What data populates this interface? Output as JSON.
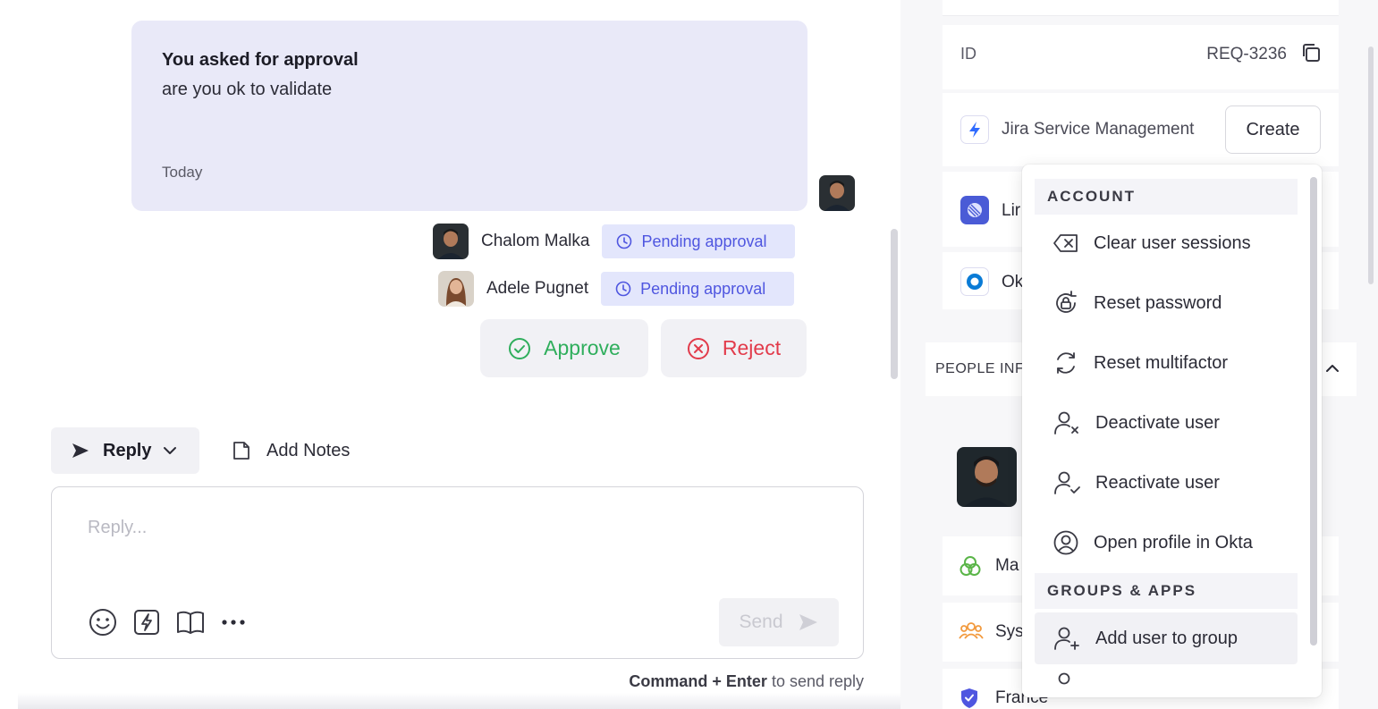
{
  "conversation": {
    "approval_message": {
      "title": "You asked for approval",
      "body": "are you ok to validate",
      "timestamp": "Today"
    },
    "approvers": [
      {
        "name": "Chalom Malka",
        "status": "Pending approval"
      },
      {
        "name": "Adele Pugnet",
        "status": "Pending approval"
      }
    ],
    "actions": {
      "approve_label": "Approve",
      "reject_label": "Reject"
    }
  },
  "composer": {
    "reply_tab_label": "Reply",
    "notes_tab_label": "Add Notes",
    "placeholder": "Reply...",
    "send_label": "Send",
    "hint_keys": "Command + Enter",
    "hint_text": " to send reply"
  },
  "sidebar": {
    "id_label": "ID",
    "id_value": "REQ-3236",
    "jira_name": "Jira Service Management",
    "create_label": "Create",
    "lin_name": "Lir",
    "okta_name": "Ok",
    "people_title": "PEOPLE INF",
    "info_rows": [
      "Ma",
      "Sys",
      "France"
    ]
  },
  "menu": {
    "section_account": "ACCOUNT",
    "items_account": [
      "Clear user sessions",
      "Reset password",
      "Reset multifactor",
      "Deactivate user",
      "Reactivate user",
      "Open profile in Okta"
    ],
    "section_groups": "GROUPS & APPS",
    "items_groups": [
      "Add user to group"
    ]
  },
  "colors": {
    "bubble_bg": "#e9e9f8",
    "pending_bg": "#e3e6fc",
    "pending_text": "#4f56e0",
    "approve": "#2fae5c",
    "reject": "#e23b4b",
    "jira_blue": "#2f6bff"
  },
  "icons": [
    "send-icon",
    "chevron-down-icon",
    "note-icon",
    "clock-icon",
    "check-circle-icon",
    "x-circle-icon",
    "emoji-icon",
    "lightning-icon",
    "book-icon",
    "more-icon",
    "copy-icon",
    "clear-sessions-icon",
    "reset-password-icon",
    "refresh-icon",
    "user-x-icon",
    "user-check-icon",
    "user-circle-icon",
    "user-plus-icon"
  ]
}
